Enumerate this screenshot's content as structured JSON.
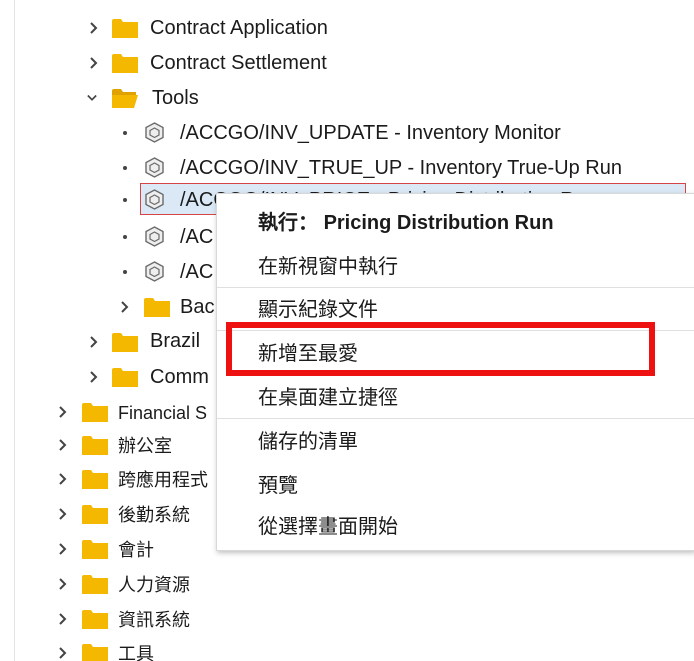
{
  "tree": {
    "items": [
      {
        "label": "Contract Application",
        "type": "folder",
        "state": "collapsed"
      },
      {
        "label": "Contract Settlement",
        "type": "folder",
        "state": "collapsed"
      },
      {
        "label": "Tools",
        "type": "folder",
        "state": "expanded"
      },
      {
        "label": "/ACCGO/INV_UPDATE - Inventory Monitor",
        "type": "transaction"
      },
      {
        "label": "/ACCGO/INV_TRUE_UP - Inventory True-Up Run",
        "type": "transaction"
      },
      {
        "label": "/ACCGO/INV_PRICE - Pricing Distribution Run",
        "type": "transaction",
        "selected": true
      },
      {
        "label": "/AC",
        "type": "transaction"
      },
      {
        "label": "/AC",
        "type": "transaction"
      },
      {
        "label": "Bac",
        "type": "folder",
        "state": "collapsed"
      },
      {
        "label": "Brazil",
        "type": "folder",
        "state": "collapsed"
      },
      {
        "label": "Comm",
        "type": "folder",
        "state": "collapsed"
      },
      {
        "label": "Financial S",
        "type": "folder",
        "state": "collapsed"
      },
      {
        "label": "辦公室",
        "type": "folder",
        "state": "collapsed"
      },
      {
        "label": "跨應用程式",
        "type": "folder",
        "state": "collapsed"
      },
      {
        "label": "後勤系統",
        "type": "folder",
        "state": "collapsed"
      },
      {
        "label": "會計",
        "type": "folder",
        "state": "collapsed"
      },
      {
        "label": "人力資源",
        "type": "folder",
        "state": "collapsed"
      },
      {
        "label": "資訊系統",
        "type": "folder",
        "state": "collapsed"
      },
      {
        "label": "工具",
        "type": "folder",
        "state": "collapsed"
      }
    ]
  },
  "context_menu": {
    "execute_prefix": "執行：",
    "execute_target": "Pricing Distribution Run",
    "items": [
      "在新視窗中執行",
      "顯示紀錄文件",
      "新增至最愛",
      "在桌面建立捷徑",
      "儲存的清單",
      "預覽",
      "從選擇畫面開始"
    ],
    "highlighted": "新增至最愛"
  },
  "colors": {
    "folder": "#f5b800",
    "folder_dark": "#e0a200",
    "selection_bg": "#dbe9f7",
    "selection_border": "#d64545",
    "annotation_red": "#ee1111"
  },
  "icons": {
    "collapsed": "chevron-right-icon",
    "expanded": "chevron-down-icon",
    "folder": "folder-icon",
    "open_folder": "folder-open-icon",
    "transaction": "transaction-cube-icon"
  }
}
